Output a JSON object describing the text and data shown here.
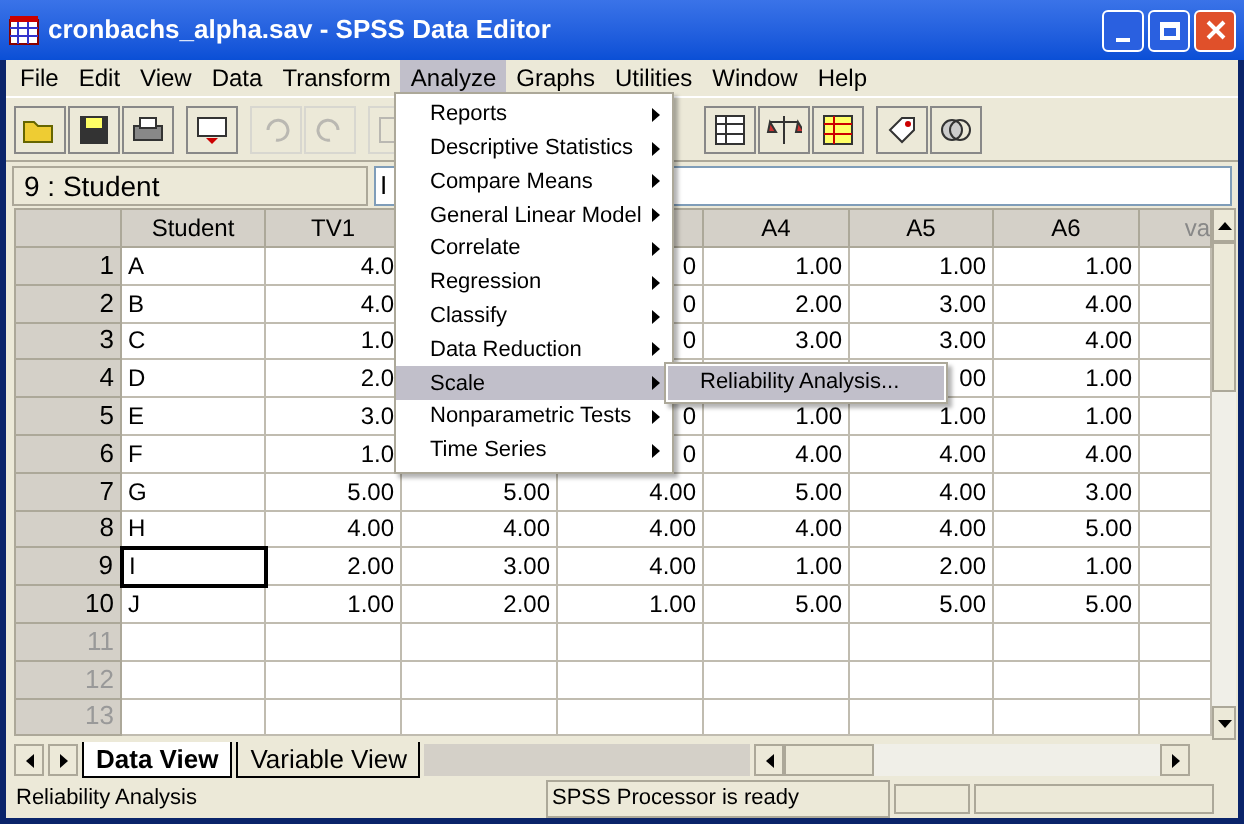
{
  "window": {
    "title": "cronbachs_alpha.sav - SPSS Data Editor"
  },
  "menu_bar": [
    {
      "label": "File",
      "selected": false
    },
    {
      "label": "Edit",
      "selected": false
    },
    {
      "label": "View",
      "selected": false
    },
    {
      "label": "Data",
      "selected": false
    },
    {
      "label": "Transform",
      "selected": false
    },
    {
      "label": "Analyze",
      "selected": true
    },
    {
      "label": "Graphs",
      "selected": false
    },
    {
      "label": "Utilities",
      "selected": false
    },
    {
      "label": "Window",
      "selected": false
    },
    {
      "label": "Help",
      "selected": false
    }
  ],
  "cell_editor": {
    "cell_name": "9 : Student",
    "value": "I"
  },
  "table": {
    "columns": [
      "Student",
      "TV1",
      null,
      null,
      "A4",
      "A5",
      "A6",
      "va"
    ],
    "rows": [
      {
        "number": "1",
        "selected": false,
        "cells": [
          "A",
          "4.0",
          null,
          "0",
          "1.00",
          "1.00",
          "1.00"
        ]
      },
      {
        "number": "2",
        "selected": false,
        "cells": [
          "B",
          "4.0",
          null,
          "0",
          "2.00",
          "3.00",
          "4.00"
        ]
      },
      {
        "number": "3",
        "selected": false,
        "cells": [
          "C",
          "1.0",
          null,
          "0",
          "3.00",
          "3.00",
          "4.00"
        ]
      },
      {
        "number": "4",
        "selected": false,
        "cells": [
          "D",
          "2.0",
          null,
          null,
          null,
          "00",
          "1.00"
        ]
      },
      {
        "number": "5",
        "selected": false,
        "cells": [
          "E",
          "3.0",
          null,
          "0",
          "1.00",
          "1.00",
          "1.00"
        ]
      },
      {
        "number": "6",
        "selected": false,
        "cells": [
          "F",
          "1.0",
          null,
          "0",
          "4.00",
          "4.00",
          "4.00"
        ]
      },
      {
        "number": "7",
        "selected": false,
        "cells": [
          "G",
          "5.00",
          "5.00",
          "4.00",
          "5.00",
          "4.00",
          "3.00"
        ]
      },
      {
        "number": "8",
        "selected": false,
        "cells": [
          "H",
          "4.00",
          "4.00",
          "4.00",
          "4.00",
          "4.00",
          "5.00"
        ]
      },
      {
        "number": "9",
        "selected": true,
        "cells": [
          "I",
          "2.00",
          "3.00",
          "4.00",
          "1.00",
          "2.00",
          "1.00"
        ]
      },
      {
        "number": "10",
        "selected": false,
        "cells": [
          "J",
          "1.00",
          "2.00",
          "1.00",
          "5.00",
          "5.00",
          "5.00"
        ]
      },
      {
        "number": "11",
        "selected": false,
        "cells": []
      },
      {
        "number": "12",
        "selected": false,
        "cells": []
      },
      {
        "number": "13",
        "selected": false,
        "cells": []
      }
    ]
  },
  "analyze_menu": [
    {
      "label": "Reports",
      "selected": false
    },
    {
      "label": "Descriptive Statistics",
      "selected": false
    },
    {
      "label": "Compare Means",
      "selected": false
    },
    {
      "label": "General Linear Model",
      "selected": false
    },
    {
      "label": "Correlate",
      "selected": false
    },
    {
      "label": "Regression",
      "selected": false
    },
    {
      "label": "Classify",
      "selected": false
    },
    {
      "label": "Data Reduction",
      "selected": false
    },
    {
      "label": "Scale",
      "selected": true
    },
    {
      "label": "Nonparametric Tests",
      "selected": false
    },
    {
      "label": "Time Series",
      "selected": false
    }
  ],
  "scale_submenu": [
    {
      "label": "Reliability Analysis...",
      "selected": true
    }
  ],
  "sheet_tabs": [
    {
      "label": "Data View",
      "selected": true
    },
    {
      "label": "Variable View",
      "selected": false
    }
  ],
  "status_bar": {
    "message": "Reliability Analysis",
    "processor": "SPSS Processor  is ready"
  }
}
